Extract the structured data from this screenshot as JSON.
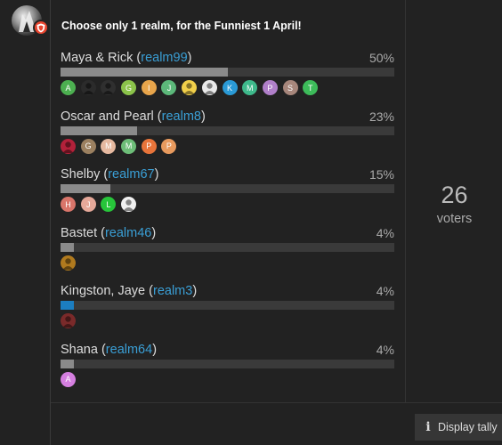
{
  "poll": {
    "title": "Choose only 1 realm, for the Funniest 1 April!",
    "options": [
      {
        "name": "Maya & Rick",
        "realm": "realm99",
        "percent_label": "50%",
        "percent": 50,
        "leading": false,
        "voters": [
          {
            "letter": "A",
            "color": "#4caf50"
          },
          {
            "letter": "",
            "color": "#2b2b2b",
            "icon": "photo-avatar-icon"
          },
          {
            "letter": "",
            "color": "#2f2f2f",
            "icon": "photo-avatar-icon"
          },
          {
            "letter": "G",
            "color": "#8bc34a"
          },
          {
            "letter": "I",
            "color": "#e8a54b"
          },
          {
            "letter": "J",
            "color": "#5cb87a"
          },
          {
            "letter": "",
            "color": "#f2d04a",
            "icon": "photo-avatar-icon"
          },
          {
            "letter": "",
            "color": "#e9e9e9",
            "icon": "photo-avatar-icon"
          },
          {
            "letter": "K",
            "color": "#2a9ad6"
          },
          {
            "letter": "M",
            "color": "#3eb98b"
          },
          {
            "letter": "P",
            "color": "#b07fc9"
          },
          {
            "letter": "S",
            "color": "#a7867b"
          },
          {
            "letter": "T",
            "color": "#3dbb5a"
          }
        ]
      },
      {
        "name": "Oscar and Pearl",
        "realm": "realm8",
        "percent_label": "23%",
        "percent": 23,
        "leading": false,
        "voters": [
          {
            "letter": "",
            "color": "#b3213a",
            "icon": "photo-avatar-icon"
          },
          {
            "letter": "G",
            "color": "#9b8060"
          },
          {
            "letter": "M",
            "color": "#e6b9a0"
          },
          {
            "letter": "M",
            "color": "#6dbd78"
          },
          {
            "letter": "P",
            "color": "#e8743a"
          },
          {
            "letter": "P",
            "color": "#e89a5e"
          }
        ]
      },
      {
        "name": "Shelby",
        "realm": "realm67",
        "percent_label": "15%",
        "percent": 15,
        "leading": false,
        "voters": [
          {
            "letter": "H",
            "color": "#d9756a"
          },
          {
            "letter": "J",
            "color": "#e5a899"
          },
          {
            "letter": "L",
            "color": "#27c53a"
          },
          {
            "letter": "",
            "color": "#f0f0f0",
            "icon": "photo-avatar-icon"
          }
        ]
      },
      {
        "name": "Bastet",
        "realm": "realm46",
        "percent_label": "4%",
        "percent": 4,
        "leading": false,
        "voters": [
          {
            "letter": "",
            "color": "#b07a1e",
            "icon": "photo-avatar-icon"
          }
        ]
      },
      {
        "name": "Kingston, Jaye",
        "realm": "realm3",
        "percent_label": "4%",
        "percent": 4,
        "leading": true,
        "voters": [
          {
            "letter": "",
            "color": "#7a2a2a",
            "icon": "photo-avatar-icon"
          }
        ]
      },
      {
        "name": "Shana",
        "realm": "realm64",
        "percent_label": "4%",
        "percent": 4,
        "leading": false,
        "voters": [
          {
            "letter": "A",
            "color": "#d57fe0"
          }
        ]
      }
    ]
  },
  "info": {
    "voter_count": "26",
    "voter_label": "voters"
  },
  "actions": {
    "display_tally_label": "Display tally"
  },
  "colors": {
    "accent": "#1c7ec1",
    "link": "#3a9fd6",
    "bar": "#8a8a8a",
    "flair": "#e8452f"
  }
}
